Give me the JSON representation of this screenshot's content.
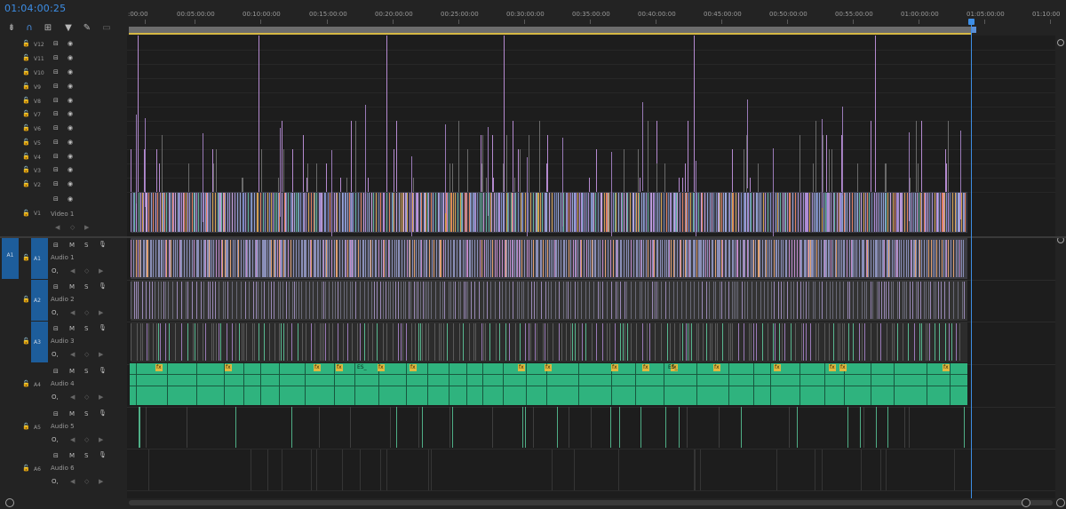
{
  "timecode": "01:04:00:25",
  "toolbar": {
    "icons": [
      "ripple-icon",
      "snap-icon",
      "linked-selection-icon",
      "marker-icon",
      "wrench-icon",
      "captions-icon"
    ]
  },
  "ruler": {
    "labels": [
      ":00:00",
      "00:05:00:00",
      "00:10:00:00",
      "00:15:00:00",
      "00:20:00:00",
      "00:25:00:00",
      "00:30:00:00",
      "00:35:00:00",
      "00:40:00:00",
      "00:45:00:00",
      "00:50:00:00",
      "00:55:00:00",
      "01:00:00:00",
      "01:05:00:00",
      "01:10:00"
    ]
  },
  "video_tracks": [
    "V12",
    "V11",
    "V10",
    "V9",
    "V8",
    "V7",
    "V6",
    "V5",
    "V4",
    "V3",
    "V2"
  ],
  "v1": {
    "label": "V1",
    "name": "Video 1"
  },
  "audio_tracks": [
    {
      "source": "A1",
      "label": "A1",
      "name": "Audio 1"
    },
    {
      "source": "",
      "label": "A2",
      "name": "Audio 2"
    },
    {
      "source": "",
      "label": "A3",
      "name": "Audio 3"
    },
    {
      "source": "",
      "label": "A4",
      "name": "Audio 4"
    },
    {
      "source": "",
      "label": "A5",
      "name": "Audio 5"
    },
    {
      "source": "",
      "label": "A6",
      "name": "Audio 6"
    }
  ],
  "audio_buttons": {
    "mute": "M",
    "solo": "S"
  },
  "fx_label": "fx",
  "clip_label_short": "ES_",
  "colors": {
    "accent": "#3d8ee6",
    "clip_green": "#2fb37e",
    "clip_purple": "#9e8ac4",
    "clip_blue": "#7f95c9",
    "clip_gray": "#4a4a4a",
    "fx_yellow": "#e0b840"
  }
}
